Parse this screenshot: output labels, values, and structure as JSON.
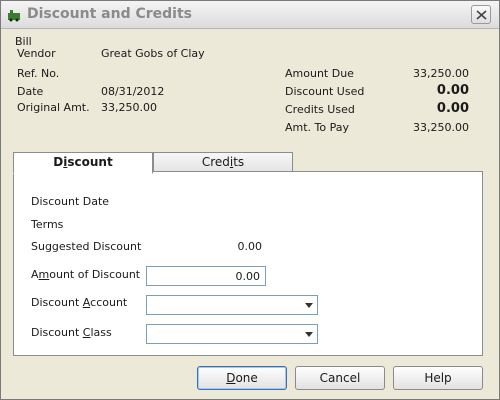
{
  "window": {
    "title": "Discount and Credits"
  },
  "bill": {
    "group_label": "Bill",
    "vendor_label": "Vendor",
    "vendor_value": "Great Gobs of Clay",
    "ref_label": "Ref. No.",
    "date_label": "Date",
    "date_value": "08/31/2012",
    "original_amt_label": "Original Amt.",
    "original_amt_value": "33,250.00",
    "amount_due_label": "Amount Due",
    "amount_due_value": "33,250.00",
    "discount_used_label": "Discount Used",
    "discount_used_value": "0.00",
    "credits_used_label": "Credits Used",
    "credits_used_value": "0.00",
    "amt_to_pay_label": "Amt. To Pay",
    "amt_to_pay_value": "33,250.00"
  },
  "tabs": [
    {
      "label_pre": "D",
      "label_ul": "i",
      "label_post": "scount",
      "active": true
    },
    {
      "label_pre": "Cred",
      "label_ul": "i",
      "label_post": "ts",
      "active": false
    }
  ],
  "discount_tab": {
    "discount_date_label": "Discount Date",
    "terms_label": "Terms",
    "suggested_discount_label": "Suggested Discount",
    "suggested_discount_value": "0.00",
    "amount_of_discount_label_pre": "A",
    "amount_of_discount_label_ul": "m",
    "amount_of_discount_label_post": "ount of Discount",
    "amount_of_discount_value": "0.00",
    "discount_account_label_pre": "Discount ",
    "discount_account_label_ul": "A",
    "discount_account_label_post": "ccount",
    "discount_class_label_pre": "Discount ",
    "discount_class_label_ul": "C",
    "discount_class_label_post": "lass"
  },
  "buttons": {
    "done_ul": "D",
    "done_post": "one",
    "cancel": "Cancel",
    "help": "Help"
  },
  "colors": {
    "window_bg": "#ece9d8",
    "panel_bg": "#ffffff",
    "default_button_border": "#3b6fb6"
  }
}
